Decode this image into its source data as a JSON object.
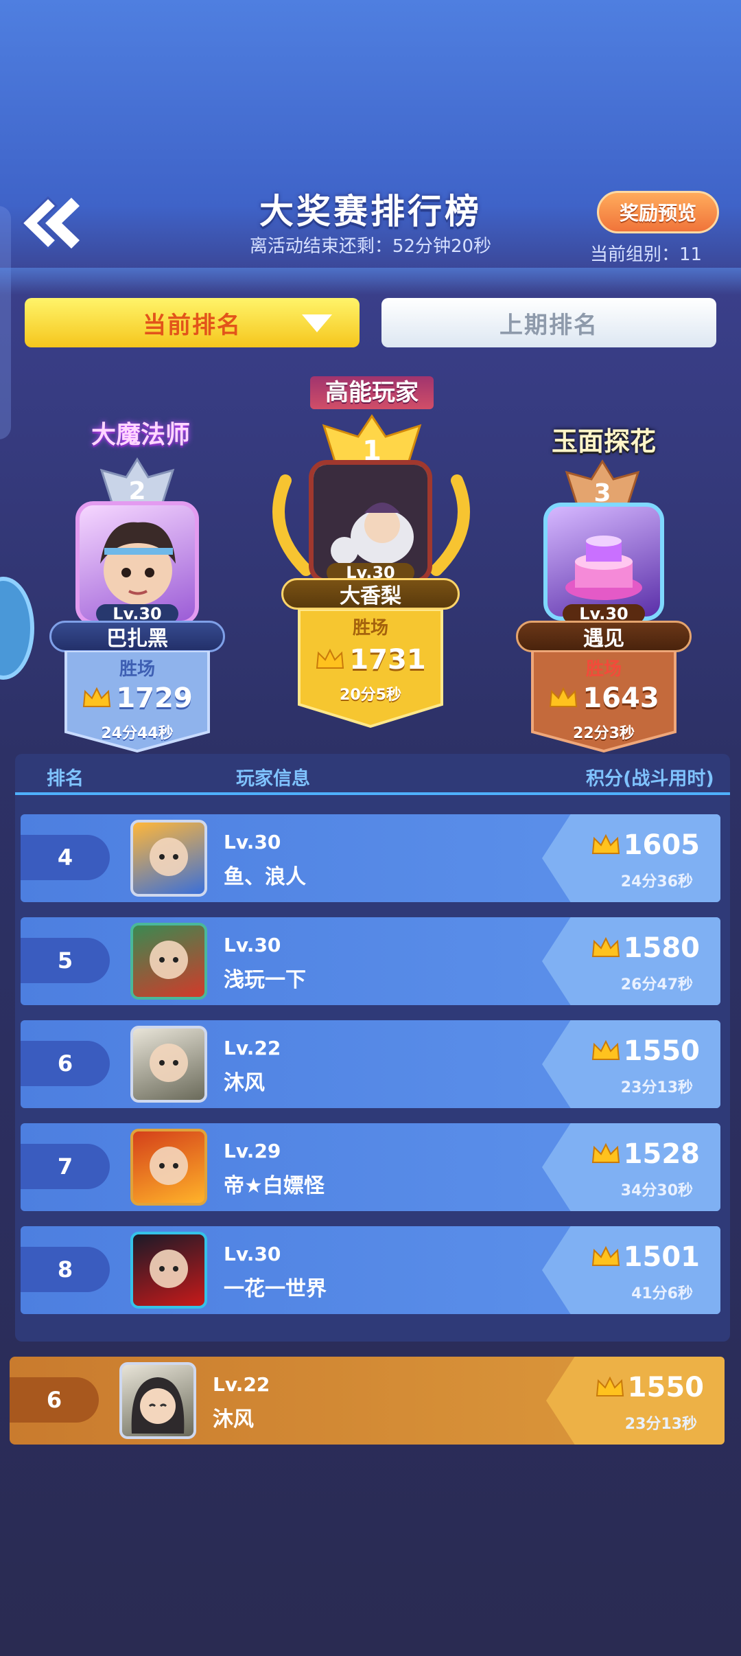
{
  "header": {
    "title": "大奖赛排行榜",
    "countdown": "离活动结束还剩：52分钟20秒",
    "reward_button": "奖励预览",
    "group": "当前组别：11"
  },
  "tabs": {
    "current": "当前排名",
    "last": "上期排名"
  },
  "podium": [
    {
      "rank": "1",
      "badge": "高能玩家",
      "level": "Lv.30",
      "name": "大香梨",
      "label": "胜场",
      "score": "1731",
      "time": "20分5秒"
    },
    {
      "rank": "2",
      "badge": "大魔法师",
      "level": "Lv.30",
      "name": "巴扎黑",
      "label": "胜场",
      "score": "1729",
      "time": "24分44秒"
    },
    {
      "rank": "3",
      "badge": "玉面探花",
      "level": "Lv.30",
      "name": "遇见",
      "label": "胜场",
      "score": "1643",
      "time": "22分3秒"
    }
  ],
  "table": {
    "headers": {
      "rank": "排名",
      "player": "玩家信息",
      "score": "积分(战斗用时)"
    },
    "rows": [
      {
        "rank": "4",
        "level": "Lv.30",
        "name": "鱼、浪人",
        "score": "1605",
        "time": "24分36秒"
      },
      {
        "rank": "5",
        "level": "Lv.30",
        "name": "浅玩一下",
        "score": "1580",
        "time": "26分47秒"
      },
      {
        "rank": "6",
        "level": "Lv.22",
        "name": "沐风",
        "score": "1550",
        "time": "23分13秒"
      },
      {
        "rank": "7",
        "level": "Lv.29",
        "name": "帝★白嫖怪",
        "score": "1528",
        "time": "34分30秒"
      },
      {
        "rank": "8",
        "level": "Lv.30",
        "name": "一花一世界",
        "score": "1501",
        "time": "41分6秒"
      }
    ]
  },
  "my_rank": {
    "rank": "6",
    "level": "Lv.22",
    "name": "沐风",
    "score": "1550",
    "time": "23分13秒"
  },
  "colors": {
    "gold": "#f5c61d",
    "silver": "#5b7fd6",
    "bronze": "#c46a3c",
    "accent": "#4fb0ff"
  }
}
